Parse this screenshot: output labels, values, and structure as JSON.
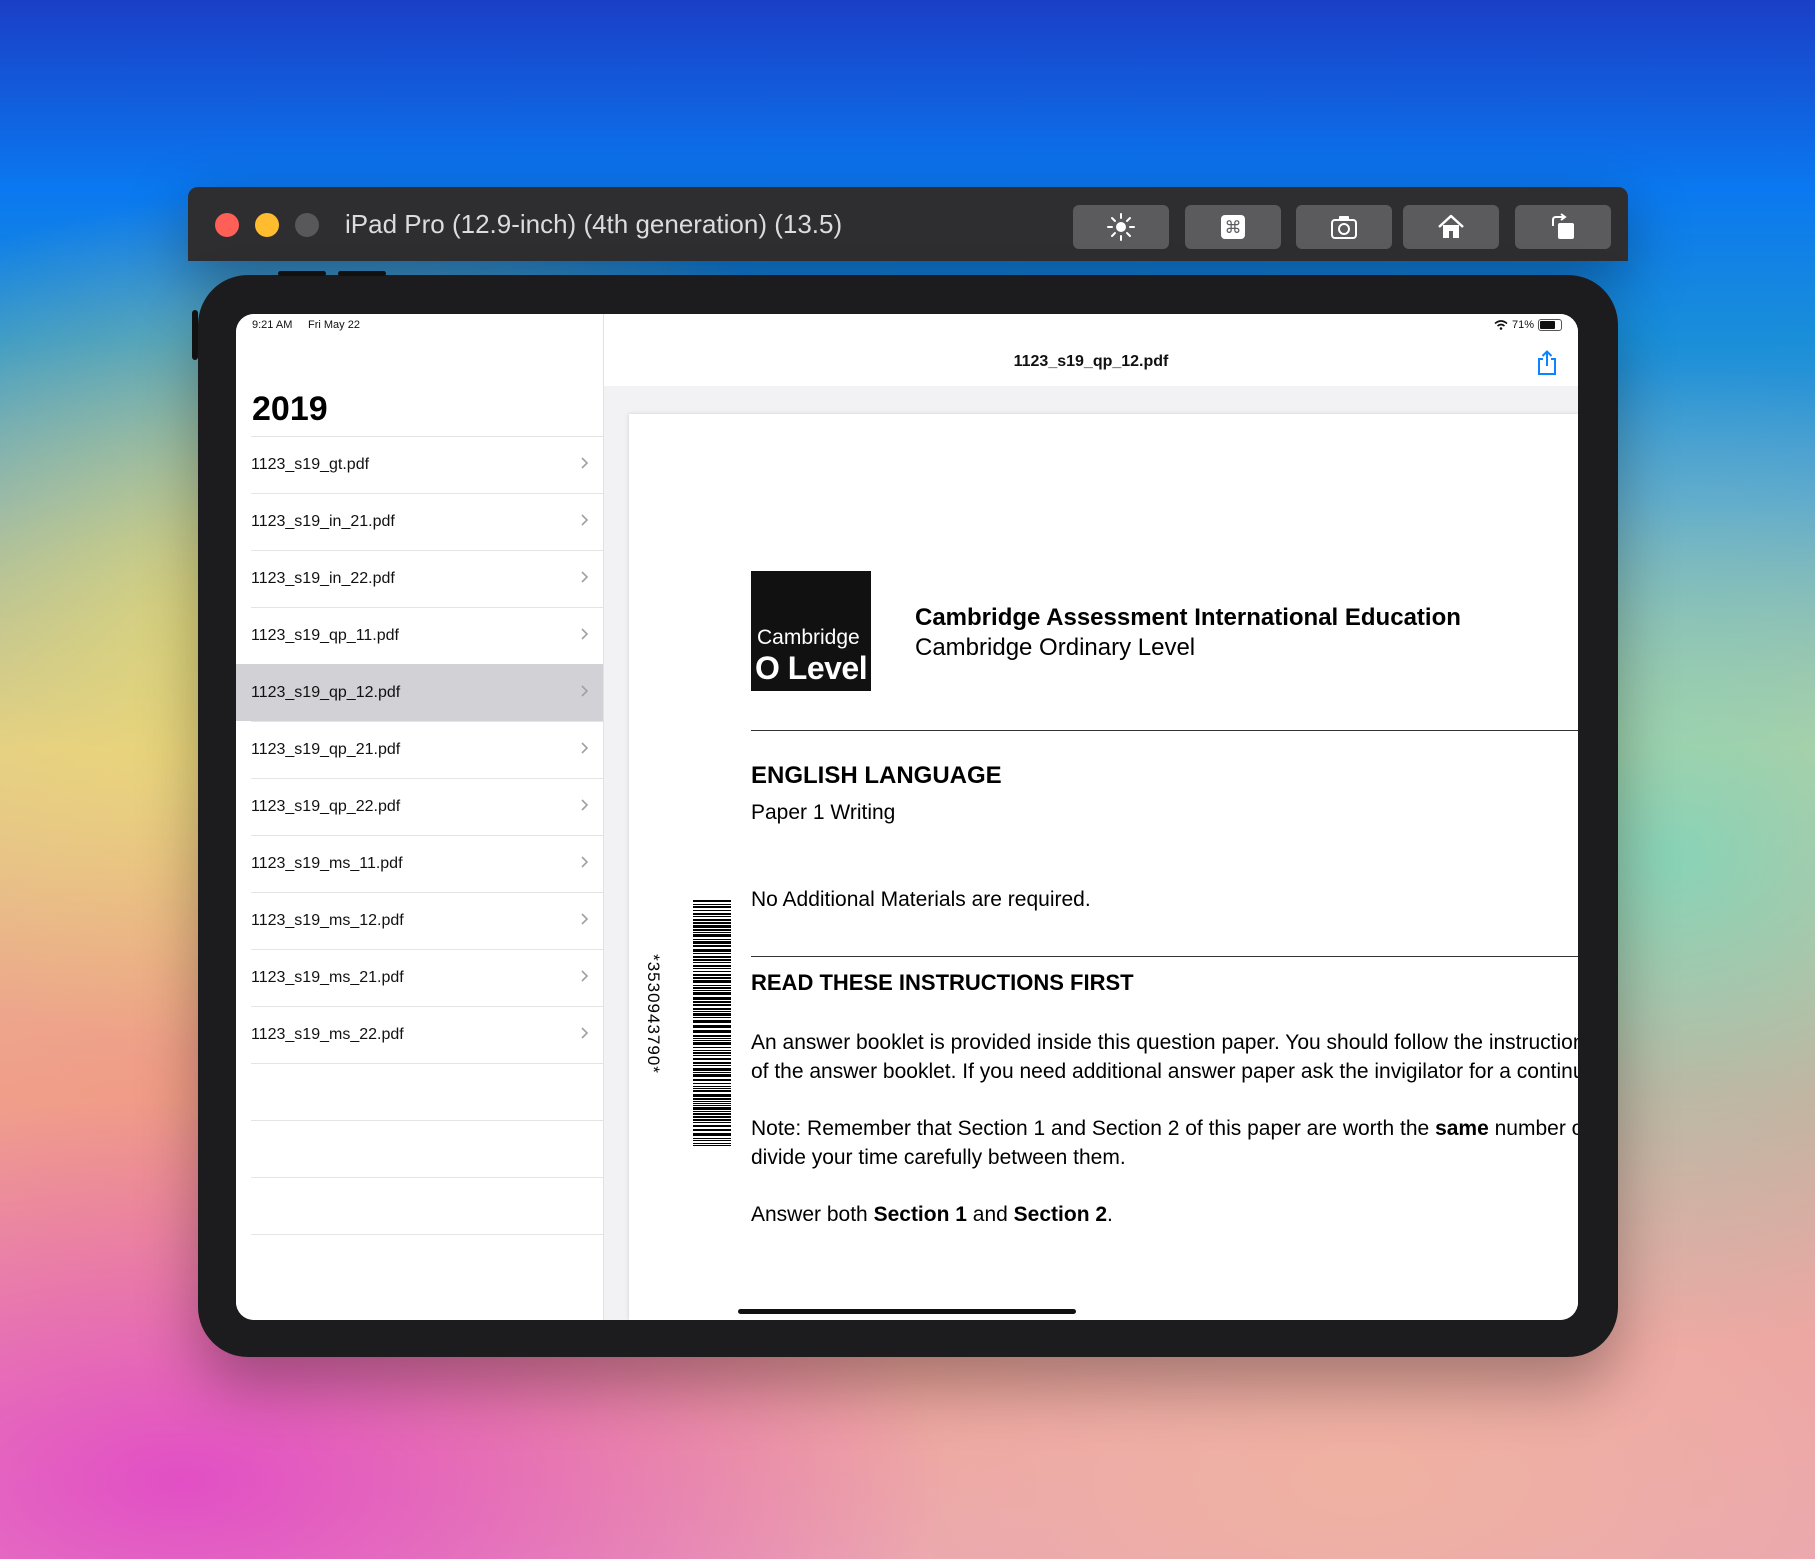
{
  "window": {
    "title": "iPad Pro (12.9-inch) (4th generation) (13.5)",
    "toolbar": [
      {
        "icon": "brightness-icon"
      },
      {
        "icon": "command-icon"
      },
      {
        "icon": "screenshot-icon"
      },
      {
        "icon": "home-icon"
      },
      {
        "icon": "rotate-icon"
      }
    ]
  },
  "status": {
    "time": "9:21 AM",
    "date": "Fri May 22",
    "battery": "71%"
  },
  "sidebar": {
    "title": "2019",
    "selected_index": 4,
    "files": [
      {
        "label": "1123_s19_gt.pdf"
      },
      {
        "label": "1123_s19_in_21.pdf"
      },
      {
        "label": "1123_s19_in_22.pdf"
      },
      {
        "label": "1123_s19_qp_11.pdf"
      },
      {
        "label": "1123_s19_qp_12.pdf"
      },
      {
        "label": "1123_s19_qp_21.pdf"
      },
      {
        "label": "1123_s19_qp_22.pdf"
      },
      {
        "label": "1123_s19_ms_11.pdf"
      },
      {
        "label": "1123_s19_ms_12.pdf"
      },
      {
        "label": "1123_s19_ms_21.pdf"
      },
      {
        "label": "1123_s19_ms_22.pdf"
      }
    ]
  },
  "detail": {
    "title": "1123_s19_qp_12.pdf",
    "share_icon": "share-icon"
  },
  "document": {
    "logo_line1": "Cambridge",
    "logo_line2": "O Level",
    "org_name": "Cambridge Assessment International Education",
    "org_sub": "Cambridge Ordinary Level",
    "subject": "ENGLISH LANGUAGE",
    "paper": "Paper 1 Writing",
    "materials": "No Additional Materials are required.",
    "barcode_number": "*3530943790*",
    "instructions_heading": "READ THESE INSTRUCTIONS FIRST",
    "para1_line1": "An answer booklet is provided inside this question paper. You should follow the instructions on the front cover",
    "para1_line2": "of the answer booklet. If you need additional answer paper ask the invigilator for a continuation booklet.",
    "para2_line1_a": "Note: Remember that Section 1 and Section 2 of this paper are worth the ",
    "para2_line1_b": "same",
    "para2_line1_c": " number of marks. You should",
    "para2_line2": "divide your time carefully between them.",
    "para3_a": "Answer both ",
    "para3_b": "Section 1",
    "para3_c": " and ",
    "para3_d": "Section 2",
    "para3_e": "."
  },
  "colors": {
    "close": "#fe5f57",
    "minimize": "#febc2e",
    "zoom": "#58575a",
    "selected_row": "#d1d1d6",
    "accent": "#0a84ff"
  }
}
